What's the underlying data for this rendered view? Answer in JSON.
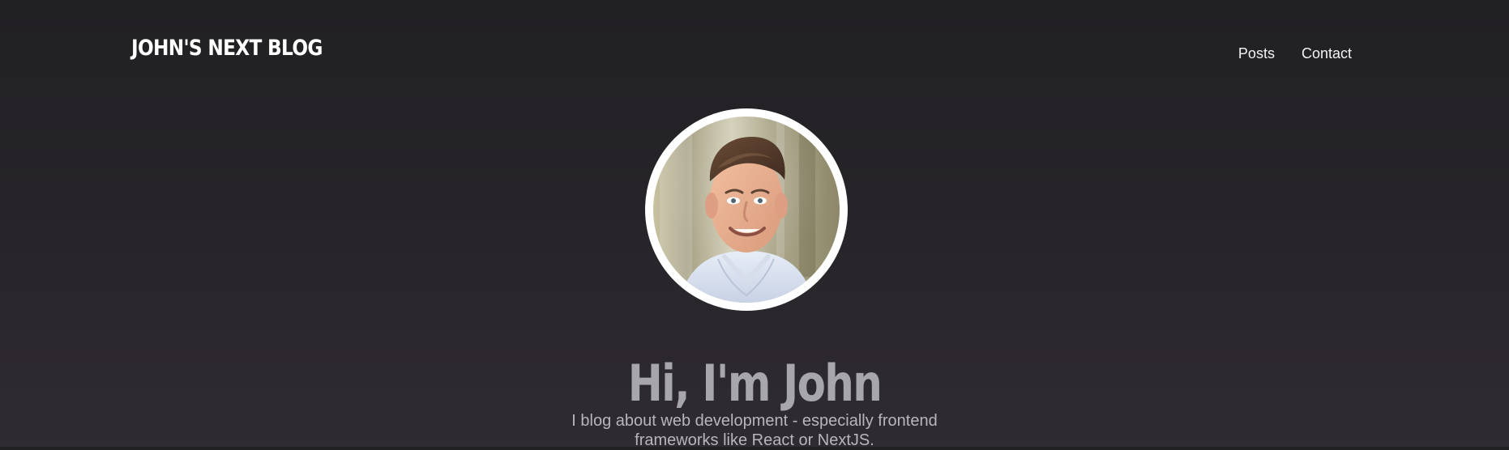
{
  "header": {
    "logo": "JOHN'S NEXT BLOG",
    "nav": {
      "items": [
        {
          "label": "Posts"
        },
        {
          "label": "Contact"
        }
      ]
    }
  },
  "hero": {
    "heading": "Hi, I'm John",
    "description": "I blog about web development - especially frontend frameworks like React or NextJS."
  },
  "colors": {
    "background_top": "#212023",
    "background_bottom": "#2f2b32",
    "heading": "#a8a6ad",
    "text": "#b9b5bd"
  },
  "icons": {
    "profile": "profile-photo"
  }
}
